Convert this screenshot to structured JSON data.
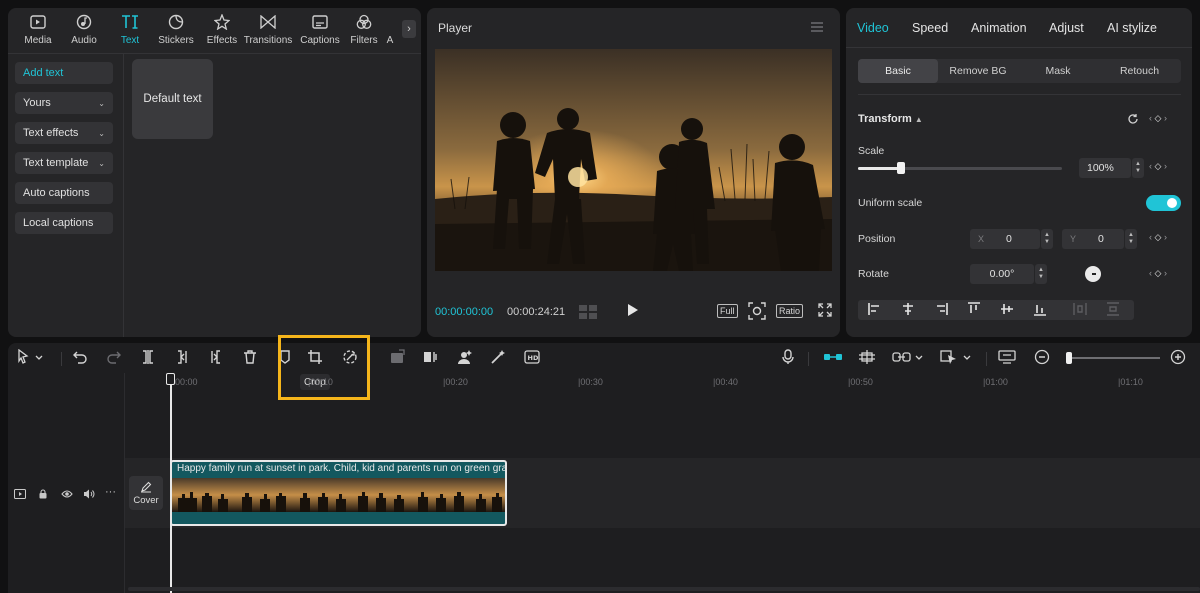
{
  "media_tabs": [
    {
      "label": "Media",
      "icon": "media-icon"
    },
    {
      "label": "Audio",
      "icon": "audio-icon"
    },
    {
      "label": "Text",
      "icon": "text-icon",
      "active": true
    },
    {
      "label": "Stickers",
      "icon": "stickers-icon"
    },
    {
      "label": "Effects",
      "icon": "effects-icon"
    },
    {
      "label": "Transitions",
      "icon": "transitions-icon"
    },
    {
      "label": "Captions",
      "icon": "captions-icon"
    },
    {
      "label": "Filters",
      "icon": "filters-icon"
    },
    {
      "label": "A",
      "icon": "adjust-icon"
    }
  ],
  "text_sidebar": [
    {
      "label": "Add text",
      "active": true
    },
    {
      "label": "Yours",
      "chevron": true
    },
    {
      "label": "Text effects",
      "chevron": true
    },
    {
      "label": "Text template",
      "chevron": true
    },
    {
      "label": "Auto captions"
    },
    {
      "label": "Local captions"
    }
  ],
  "default_text_card": "Default text",
  "player": {
    "title": "Player",
    "timecode_current": "00:00:00:00",
    "timecode_total": "00:00:24:21",
    "full_label": "Full",
    "ratio_label": "Ratio"
  },
  "inspector": {
    "tabs": [
      "Video",
      "Speed",
      "Animation",
      "Adjust",
      "AI stylize"
    ],
    "subtabs": [
      "Basic",
      "Remove BG",
      "Mask",
      "Retouch"
    ],
    "transform_title": "Transform",
    "scale_label": "Scale",
    "scale_value": "100%",
    "scale_slider_fraction": 0.2,
    "uniform_scale_label": "Uniform scale",
    "uniform_scale_on": true,
    "position_label": "Position",
    "position_x_label": "X",
    "position_x": "0",
    "position_y_label": "Y",
    "position_y": "0",
    "rotate_label": "Rotate",
    "rotate_value": "0.00°"
  },
  "timeline": {
    "tooltip": "Crop",
    "ruler": [
      "00:00",
      "|00:10",
      "|00:20",
      "|00:30",
      "|00:40",
      "|00:50",
      "|01:00",
      "|01:10"
    ],
    "cover_label": "Cover",
    "clip_title": "Happy family run at sunset in park. Child, kid and parents run on green grass",
    "zoom_fraction": 0.05
  },
  "colors": {
    "accent": "#20c4d6",
    "highlight": "#f5b51b",
    "panel": "#252527",
    "background": "#111112"
  }
}
